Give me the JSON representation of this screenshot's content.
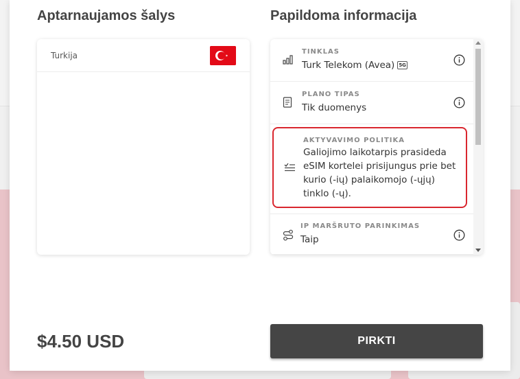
{
  "countries": {
    "title": "Aptarnaujamos šalys",
    "items": [
      {
        "name": "Turkija",
        "flag": "turkey-flag"
      }
    ]
  },
  "info": {
    "title": "Papildoma informacija",
    "network": {
      "label": "TINKLAS",
      "value": "Turk Telekom (Avea)",
      "badge": "5G"
    },
    "plan": {
      "label": "PLANO TIPAS",
      "value": "Tik duomenys"
    },
    "activation": {
      "label": "AKTYVAVIMO POLITIKA",
      "value_lines": [
        "Galiojimo laikotarpis prasideda",
        "eSIM kortelei prisijungus prie bet",
        "kurio (-ių) palaikomojo (-ųjų)",
        "tinklo (-ų)."
      ]
    },
    "ip": {
      "label": "IP MARŠRUTO PARINKIMAS",
      "value": "Taip"
    }
  },
  "footer": {
    "price": "$4.50 USD",
    "buy_label": "PIRKTI"
  },
  "colors": {
    "highlight_border": "#d9262e",
    "button_bg": "#454545",
    "flag_red": "#e30a17"
  }
}
